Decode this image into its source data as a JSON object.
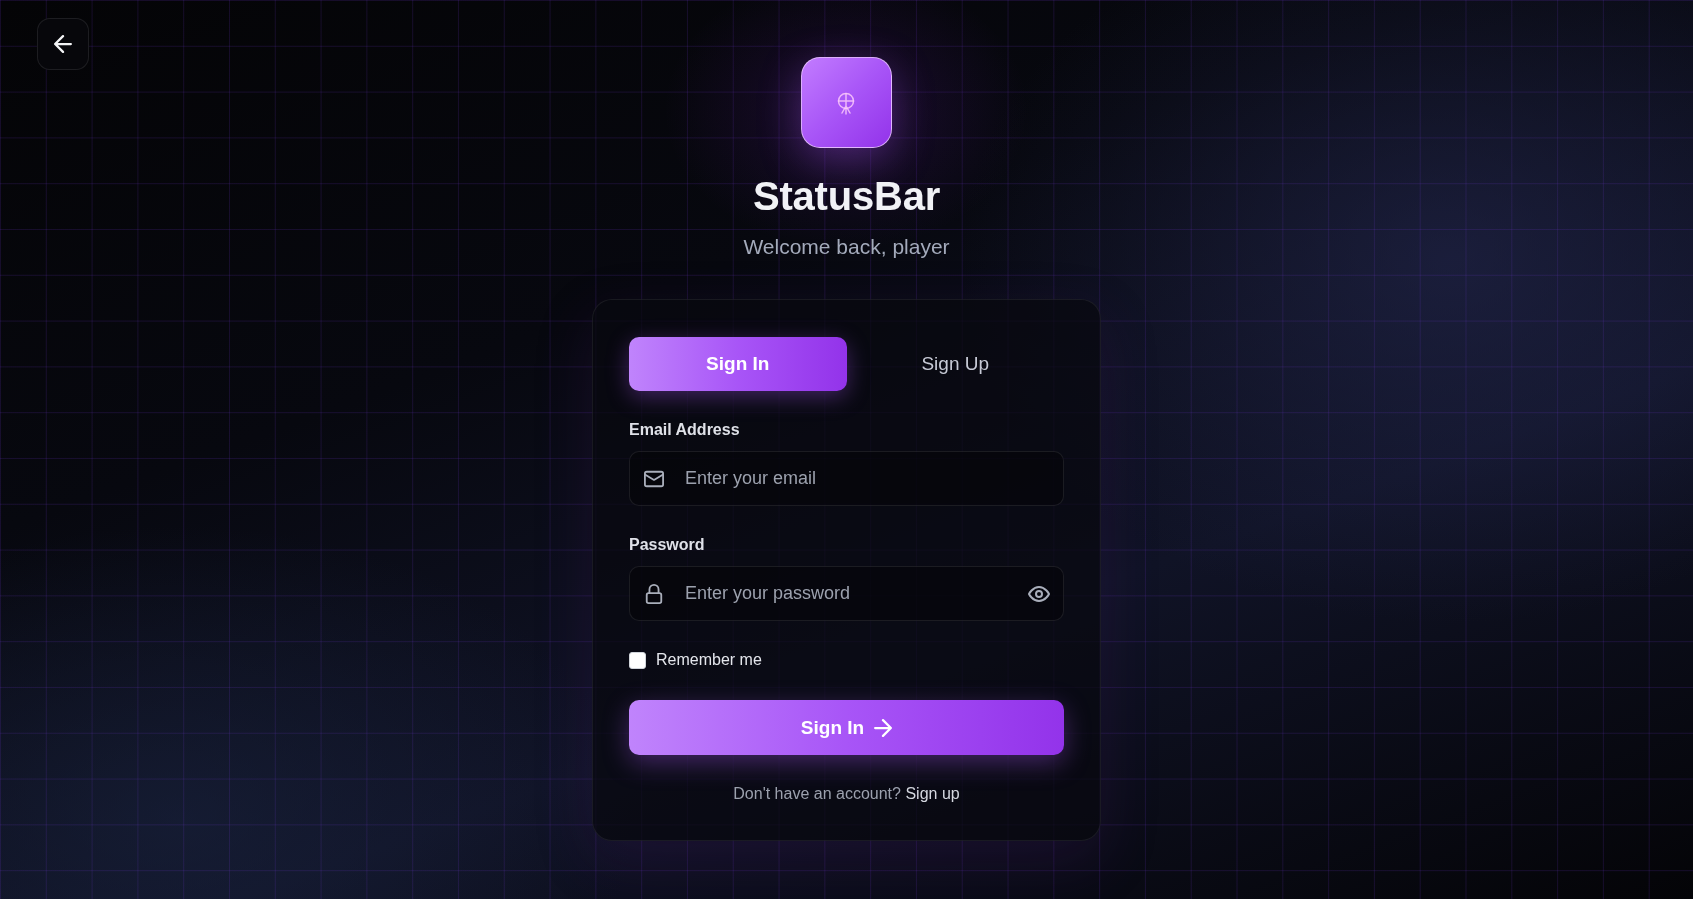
{
  "app": {
    "name": "StatusBar",
    "tagline": "Welcome back, player"
  },
  "tabs": [
    {
      "label": "Sign In",
      "selected": true
    },
    {
      "label": "Sign Up",
      "selected": false
    }
  ],
  "fields": [
    {
      "kind": "email",
      "label": "Email Address",
      "placeholder": "Enter your email"
    },
    {
      "kind": "password",
      "label": "Password",
      "placeholder": "Enter your password"
    }
  ],
  "remember": {
    "label": "Remember me",
    "checked": false
  },
  "submit": {
    "label": "Sign In"
  },
  "footer": {
    "text": "Don't have an account?",
    "link": "Sign up"
  }
}
